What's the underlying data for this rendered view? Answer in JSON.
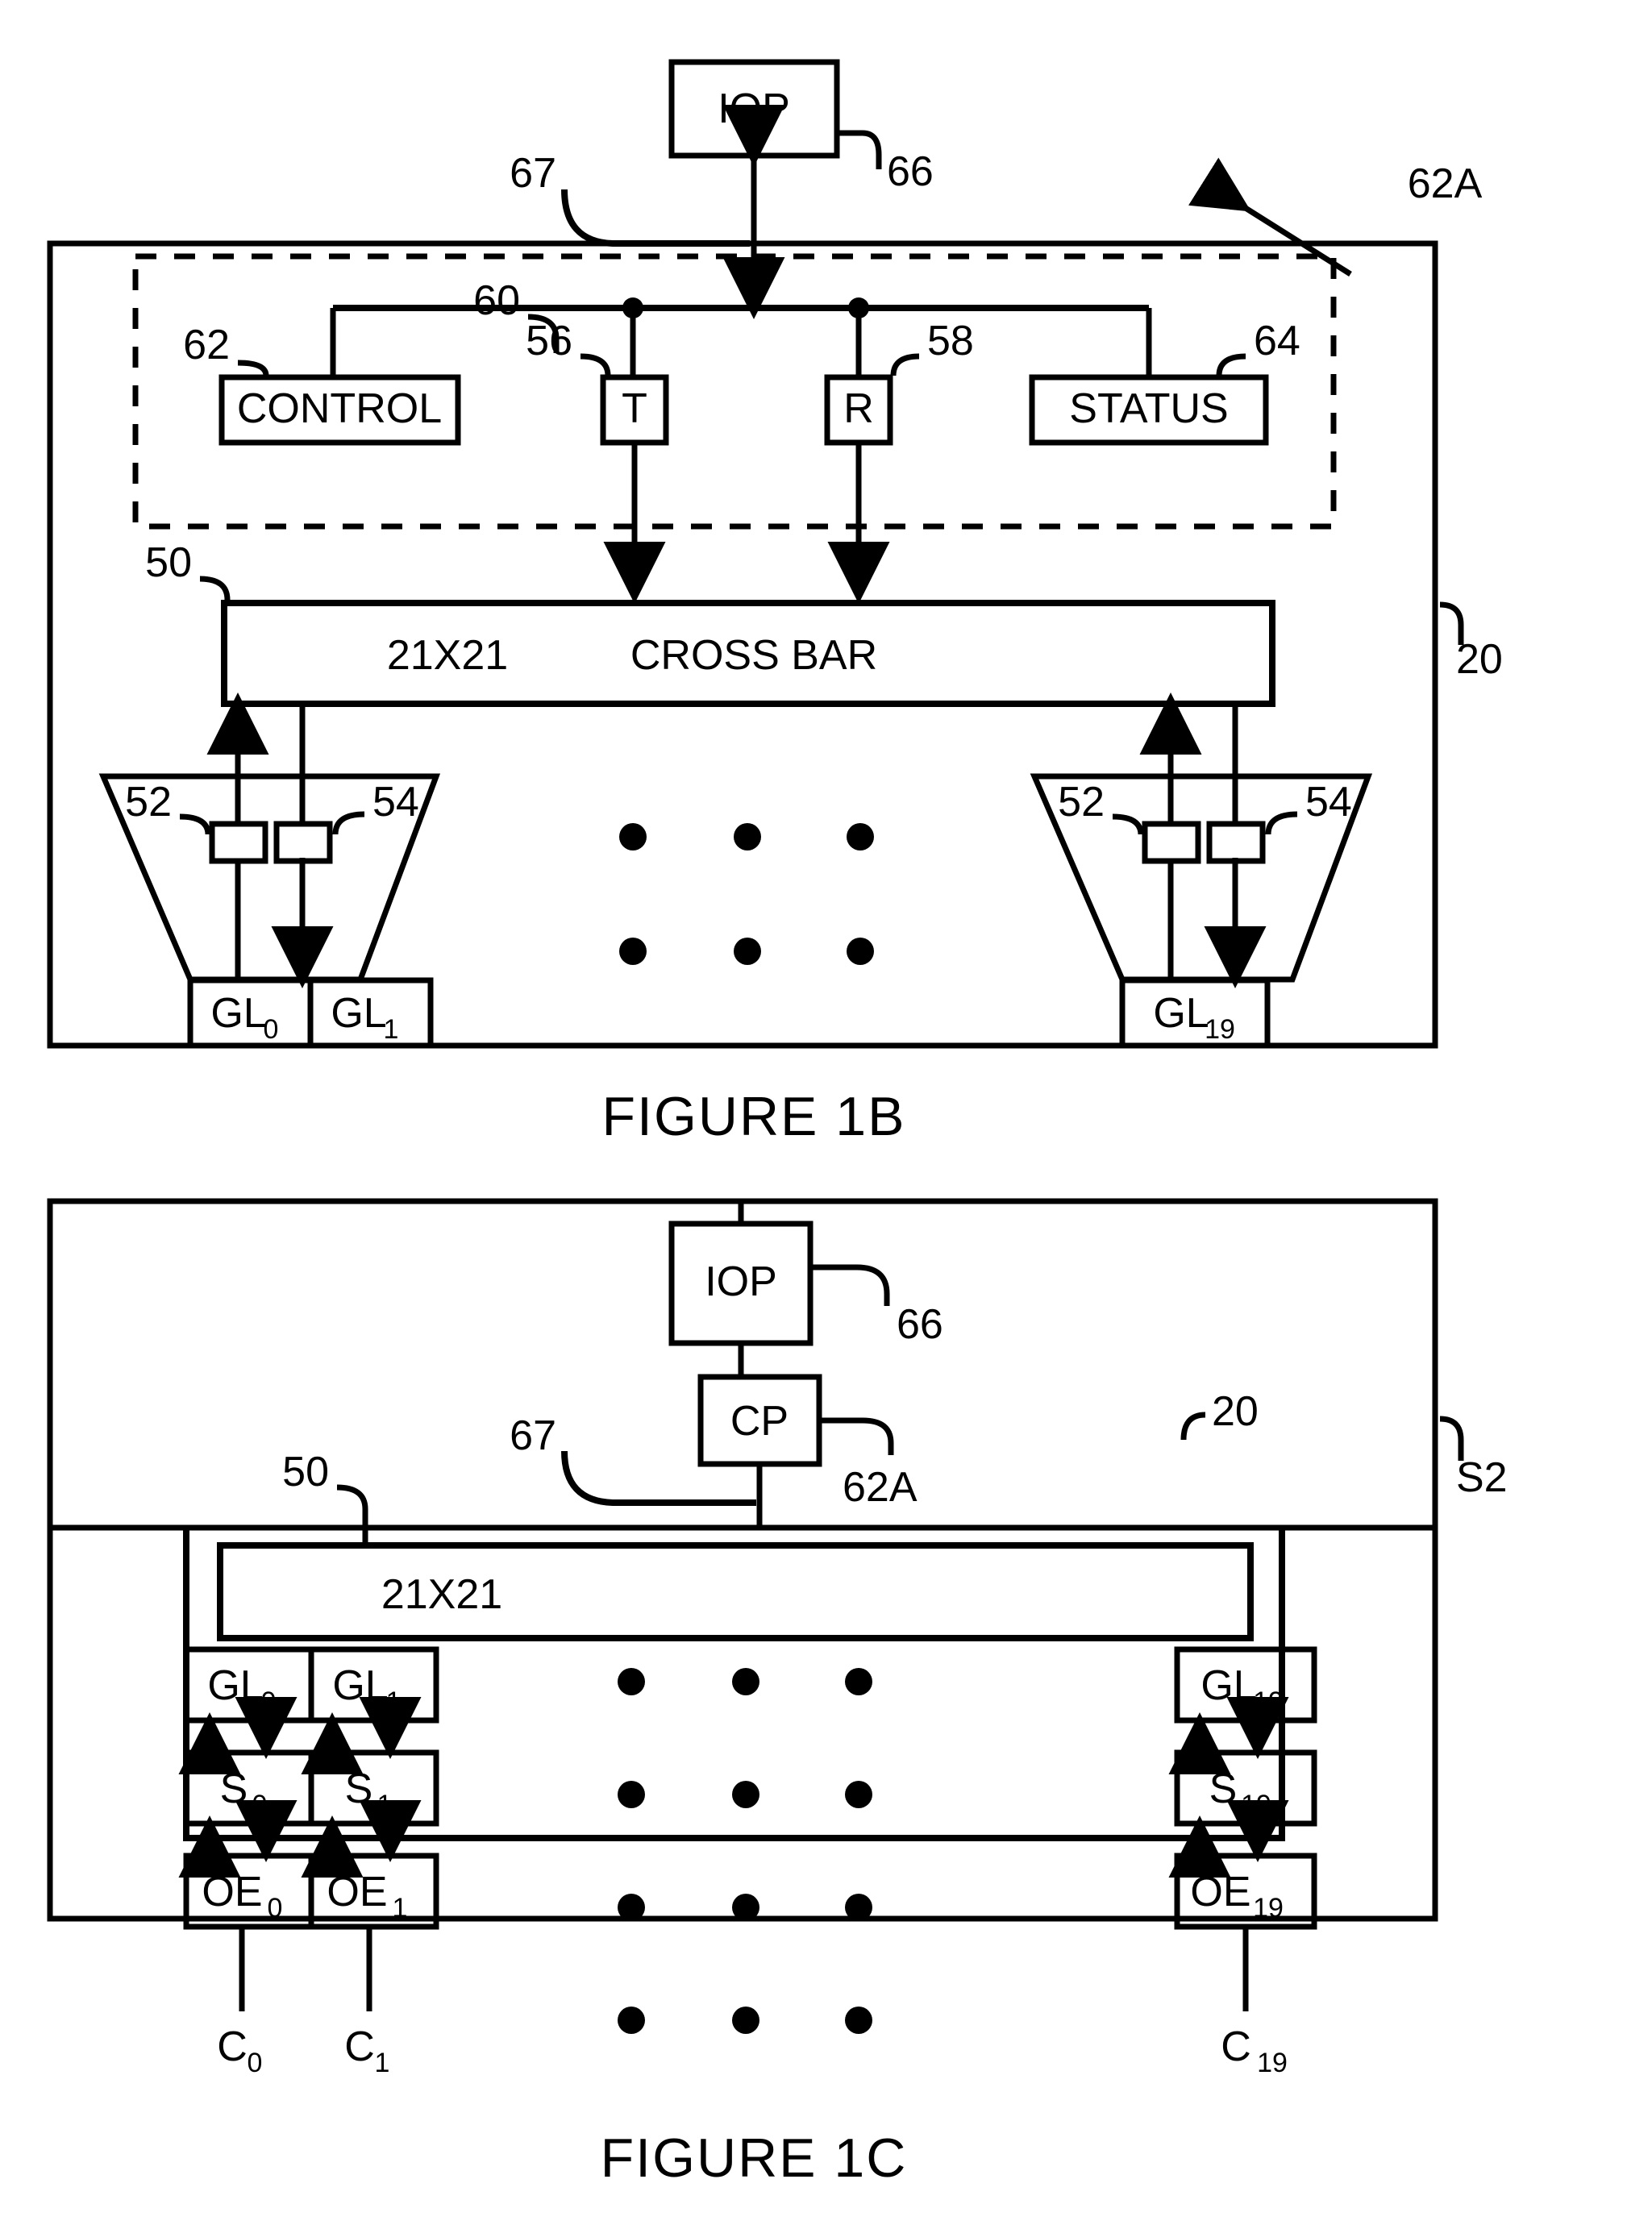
{
  "page": {
    "background": "#ffffff",
    "ink": "#000000"
  },
  "figures": [
    {
      "id": "figure-1b",
      "caption": "FIGURE 1B",
      "outer_ref": "20",
      "dashed_group_ref": "62A",
      "blocks": [
        {
          "name": "iop",
          "label": "IOP",
          "ref": "66"
        },
        {
          "name": "control",
          "label": "CONTROL",
          "ref": "62"
        },
        {
          "name": "transmit",
          "label": "T",
          "ref": "56"
        },
        {
          "name": "receive",
          "label": "R",
          "ref": "58"
        },
        {
          "name": "status",
          "label": "STATUS",
          "ref": "64"
        },
        {
          "name": "crossbar",
          "label_left": "21X21",
          "label_right": "CROSS BAR",
          "ref": "50"
        }
      ],
      "bus_ref": "60",
      "iop_link_ref": "67",
      "funnels": [
        {
          "side": "left",
          "refs": [
            "52",
            "54"
          ],
          "glinks": [
            "GL",
            "GL"
          ],
          "glink_subs": [
            "0",
            "1"
          ]
        },
        {
          "side": "right",
          "refs": [
            "52",
            "54"
          ],
          "glinks": [
            "GL"
          ],
          "glink_subs": [
            "19"
          ]
        }
      ],
      "ellipsis_dots": {
        "rows": 2,
        "cols": 3
      }
    },
    {
      "id": "figure-1c",
      "caption": "FIGURE 1C",
      "outer_ref": "20",
      "system_ref": "S2",
      "blocks": [
        {
          "name": "iop",
          "label": "IOP",
          "ref": "66"
        },
        {
          "name": "cp",
          "label": "CP",
          "ref": "62A"
        },
        {
          "name": "crossbar",
          "label": "21X21",
          "ref": "50"
        }
      ],
      "cp_link_ref": "67",
      "columns": [
        {
          "gl": "GL",
          "gl_sub": "0",
          "s": "S",
          "s_sub": "0",
          "oe": "OE",
          "oe_sub": "0",
          "c": "C",
          "c_sub": "0"
        },
        {
          "gl": "GL",
          "gl_sub": "1",
          "s": "S",
          "s_sub": "1",
          "oe": "OE",
          "oe_sub": "1",
          "c": "C",
          "c_sub": "1"
        },
        {
          "gl": "GL",
          "gl_sub": "19",
          "s": "S",
          "s_sub": "19",
          "oe": "OE",
          "oe_sub": "19",
          "c": "C",
          "c_sub": "19"
        }
      ],
      "ellipsis_dots": {
        "rows": 4,
        "cols": 3
      }
    }
  ]
}
